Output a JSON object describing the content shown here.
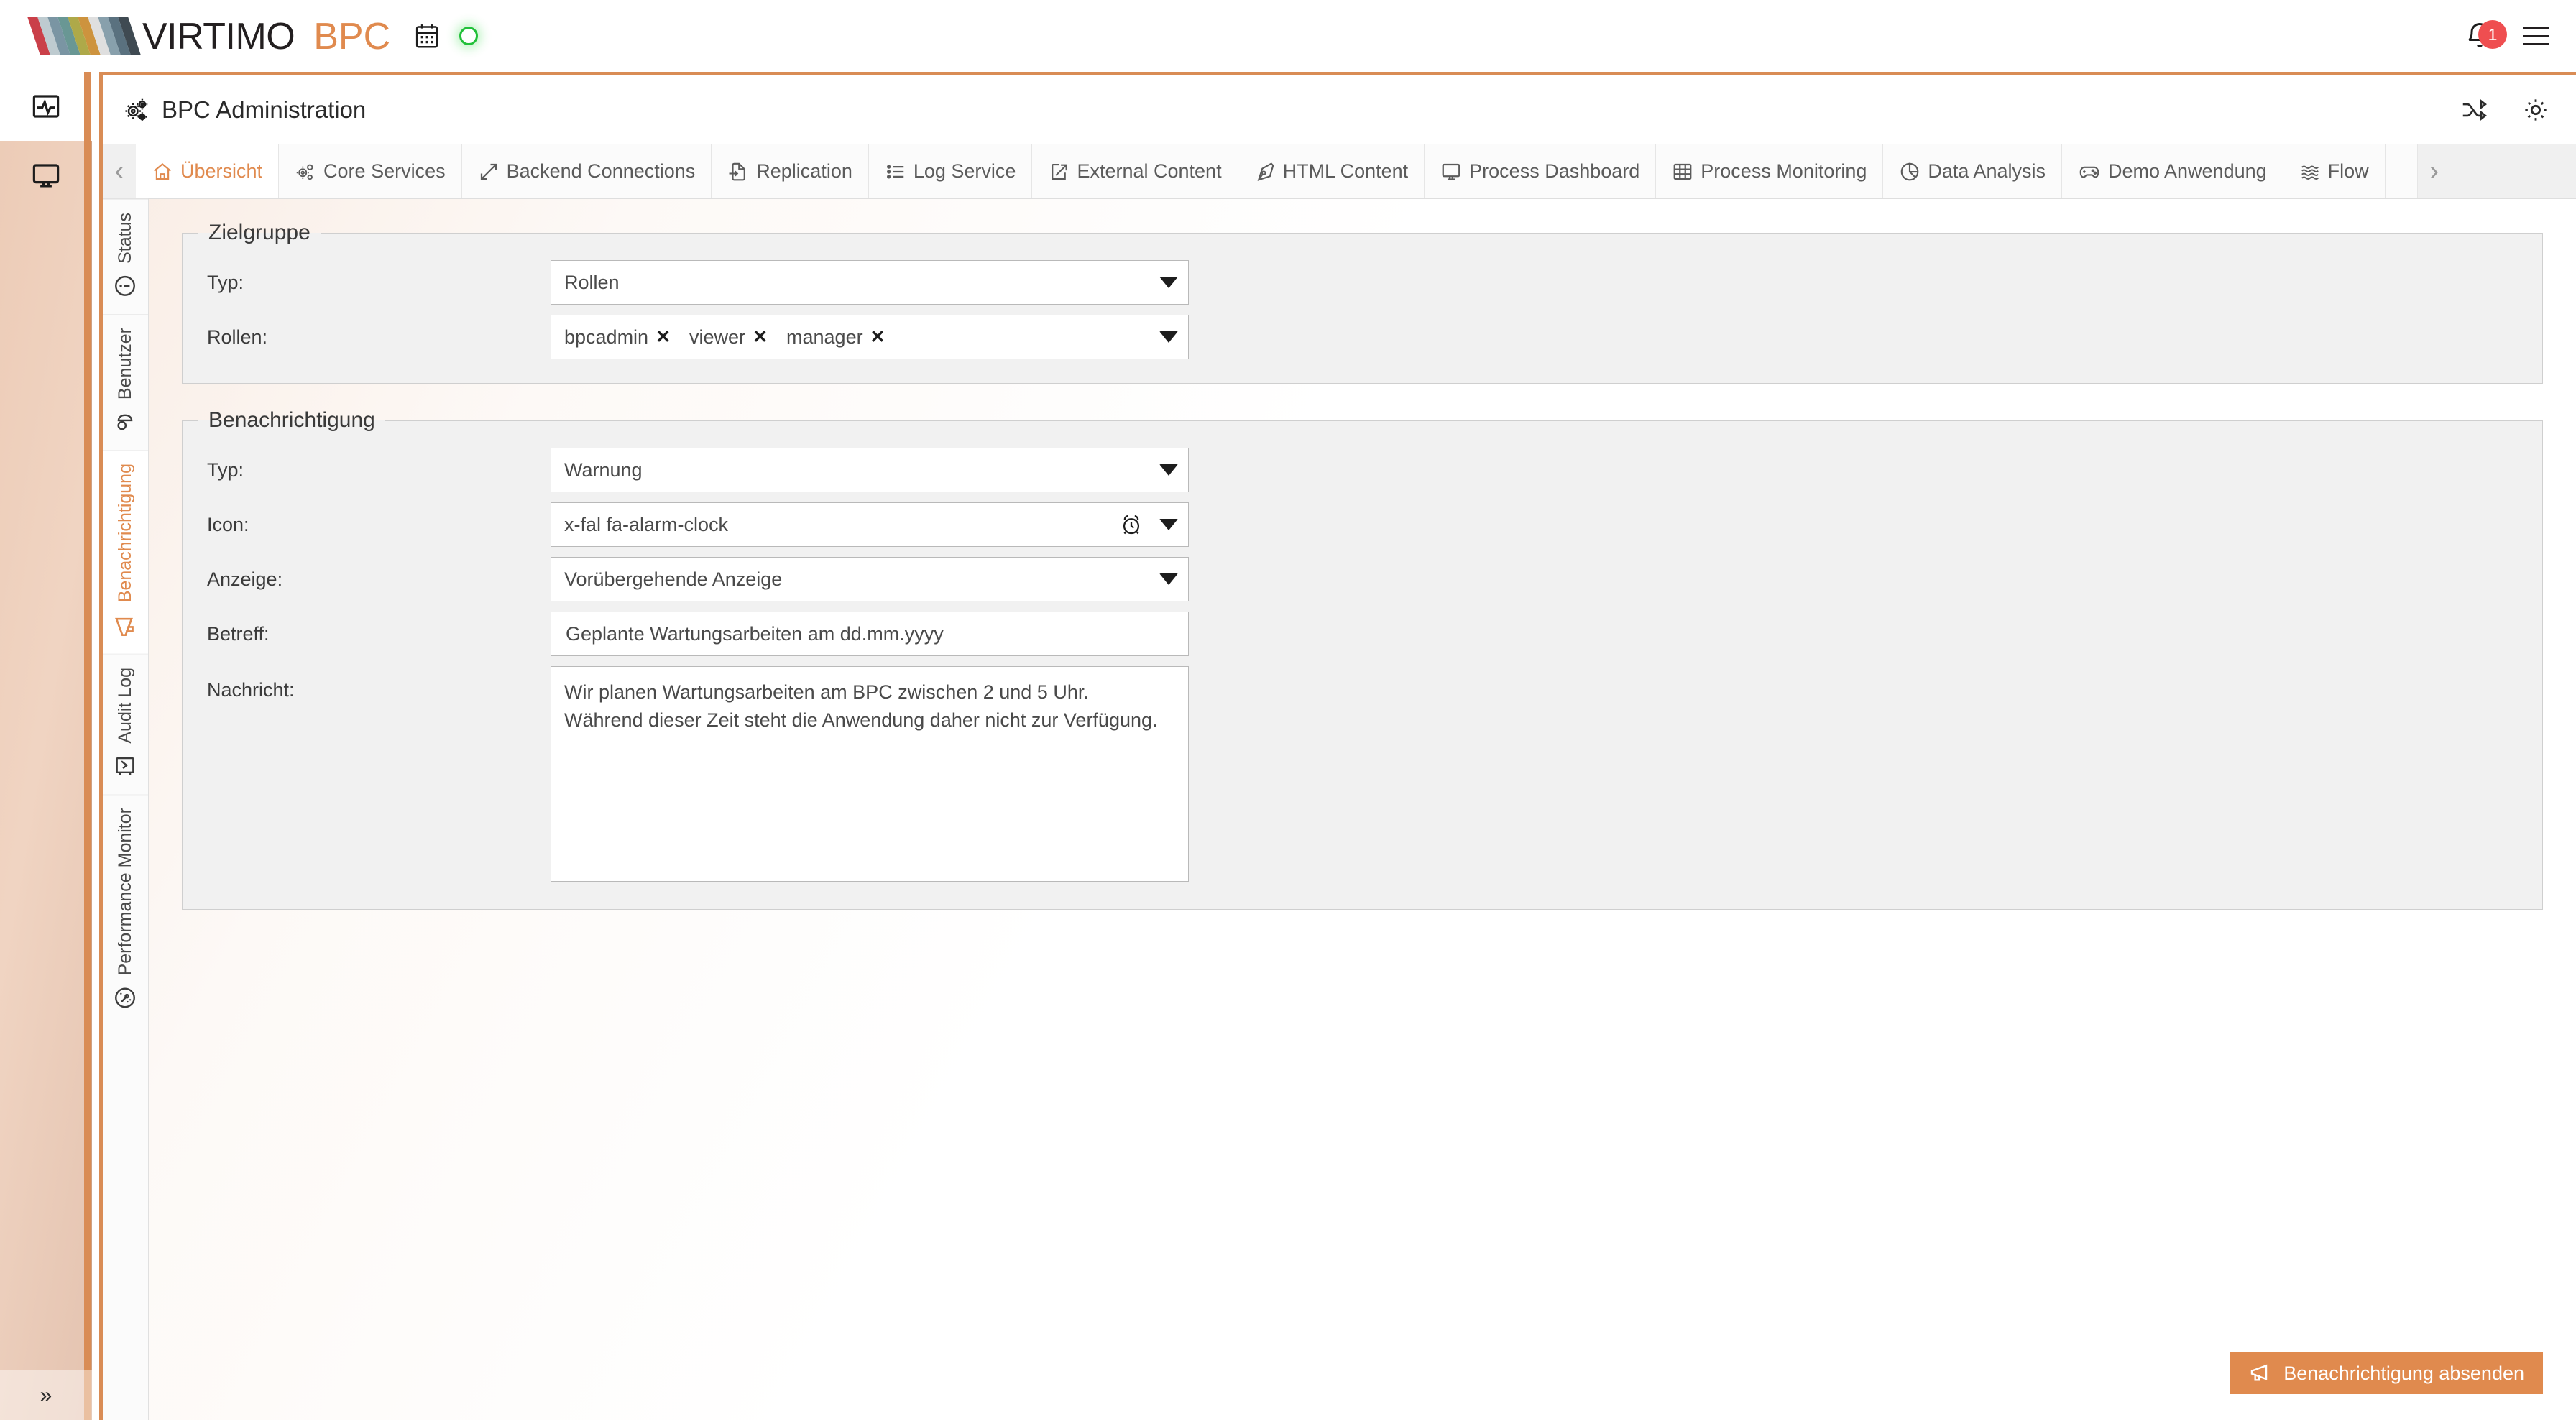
{
  "topbar": {
    "brand_name": "VIRTIMO",
    "brand_product": "BPC",
    "calendar_icon": "calendar-icon",
    "status_dot": "status-online-indicator",
    "notification_count": "1",
    "menu_icon": "hamburger-menu-icon",
    "brand_accent": "#e08a4e",
    "status_green": "#22c03a",
    "badge_red": "#ef4e50"
  },
  "rail": {
    "items": [
      {
        "name": "pulse-monitor-icon",
        "active": true
      },
      {
        "name": "display-screen-icon",
        "active": false
      }
    ],
    "expand_label": "»"
  },
  "app": {
    "title": "BPC Administration",
    "title_icon": "gears-icon",
    "header_actions": [
      {
        "name": "shuffle-icon"
      },
      {
        "name": "gear-icon"
      }
    ]
  },
  "module_tabs": {
    "prev_label": "‹",
    "next_label": "›",
    "items": [
      {
        "label": "Übersicht",
        "icon": "home-icon",
        "active": true
      },
      {
        "label": "Core Services",
        "icon": "gears-icon",
        "active": false
      },
      {
        "label": "Backend Connections",
        "icon": "diagonal-arrows-icon",
        "active": false
      },
      {
        "label": "Replication",
        "icon": "file-import-icon",
        "active": false
      },
      {
        "label": "Log Service",
        "icon": "list-icon",
        "active": false
      },
      {
        "label": "External Content",
        "icon": "external-link-icon",
        "active": false
      },
      {
        "label": "HTML Content",
        "icon": "pen-nib-icon",
        "active": false
      },
      {
        "label": "Process Dashboard",
        "icon": "monitor-icon",
        "active": false
      },
      {
        "label": "Process Monitoring",
        "icon": "grid-table-icon",
        "active": false
      },
      {
        "label": "Data Analysis",
        "icon": "pie-chart-icon",
        "active": false
      },
      {
        "label": "Demo Anwendung",
        "icon": "gamepad-icon",
        "active": false
      },
      {
        "label": "Flow",
        "icon": "waves-icon",
        "active": false
      }
    ]
  },
  "side_tabs": {
    "items": [
      {
        "label": "Status",
        "icon": "info-circle-icon",
        "active": false
      },
      {
        "label": "Benutzer",
        "icon": "user-icon",
        "active": false
      },
      {
        "label": "Benachrichtigung",
        "icon": "megaphone-icon",
        "active": true
      },
      {
        "label": "Audit Log",
        "icon": "audit-check-icon",
        "active": false
      },
      {
        "label": "Performance Monitor",
        "icon": "speedometer-icon",
        "active": false
      }
    ]
  },
  "form": {
    "target_group": {
      "legend": "Zielgruppe",
      "type_label": "Typ:",
      "type_value": "Rollen",
      "roles_label": "Rollen:",
      "roles": [
        "bpcadmin",
        "viewer",
        "manager"
      ],
      "chip_remove": "✕"
    },
    "notification": {
      "legend": "Benachrichtigung",
      "type_label": "Typ:",
      "type_value": "Warnung",
      "icon_label": "Icon:",
      "icon_value": "x-fal fa-alarm-clock",
      "icon_preview": "alarm-clock-icon",
      "display_label": "Anzeige:",
      "display_value": "Vorübergehende Anzeige",
      "subject_label": "Betreff:",
      "subject_value": "Geplante Wartungsarbeiten am dd.mm.yyyy",
      "message_label": "Nachricht:",
      "message_value": "Wir planen Wartungsarbeiten am BPC zwischen 2 und 5 Uhr.\nWährend dieser Zeit steht die Anwendung daher nicht zur Verfügung."
    }
  },
  "submit": {
    "label": "Benachrichtigung absenden",
    "icon": "megaphone-icon",
    "color": "#e08a4e"
  }
}
